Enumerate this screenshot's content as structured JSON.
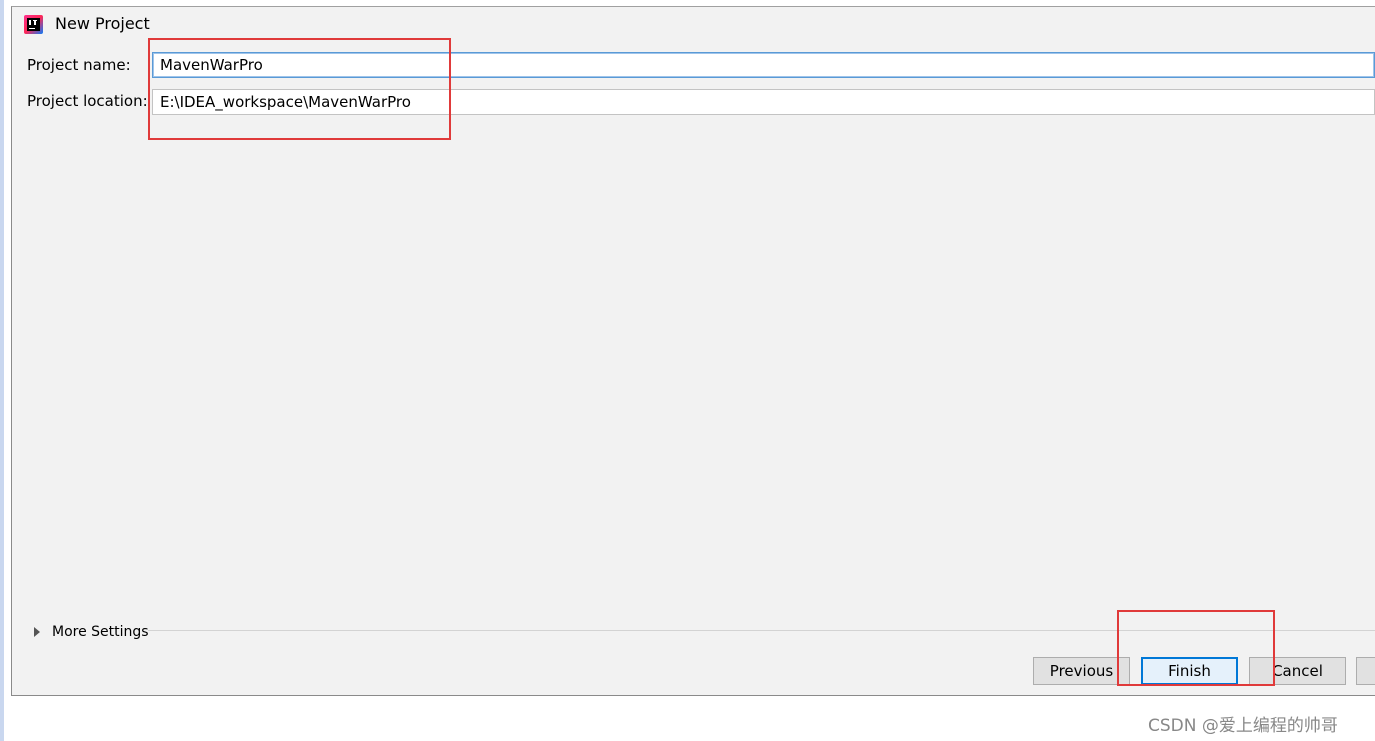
{
  "window": {
    "title": "New Project"
  },
  "form": {
    "name_label": "Project name:",
    "name_value": "MavenWarPro",
    "location_label": "Project location:",
    "location_value": "E:\\IDEA_workspace\\MavenWarPro"
  },
  "more_settings": {
    "label": "More Settings"
  },
  "buttons": {
    "previous": "Previous",
    "finish": "Finish",
    "cancel": "Cancel"
  },
  "watermark": "CSDN @爱上编程的帅哥",
  "icons": {
    "app": "intellij-idea-icon",
    "expand": "triangle-right-icon"
  },
  "colors": {
    "highlight_box": "#e03a3a",
    "default_button_border": "#0078d7",
    "focused_field_border": "#5a9ad6"
  }
}
